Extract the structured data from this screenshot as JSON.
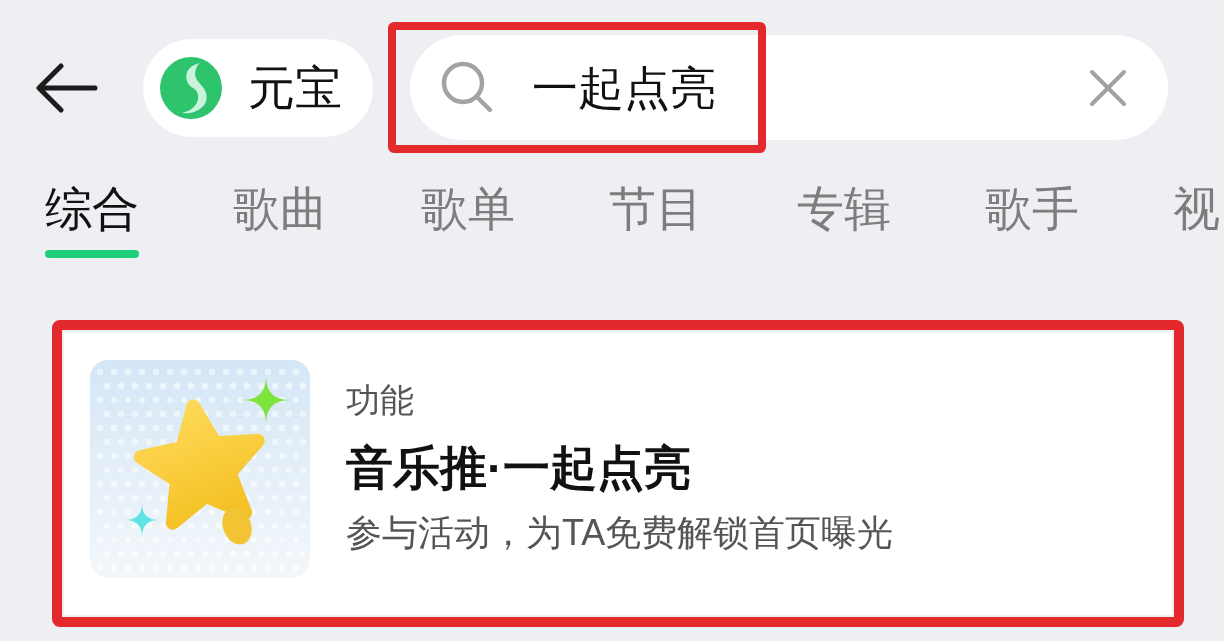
{
  "assistant_chip": {
    "label": "元宝"
  },
  "search": {
    "value": "一起点亮",
    "highlighted": true
  },
  "tabs": [
    {
      "label": "综合",
      "selected": true
    },
    {
      "label": "歌曲",
      "selected": false
    },
    {
      "label": "歌单",
      "selected": false
    },
    {
      "label": "节目",
      "selected": false
    },
    {
      "label": "专辑",
      "selected": false
    },
    {
      "label": "歌手",
      "selected": false
    },
    {
      "label": "视",
      "selected": false
    }
  ],
  "results": [
    {
      "kind": "feature",
      "category": "功能",
      "title": "音乐推·一起点亮",
      "description": "参与活动，为TA免费解锁首页曝光",
      "highlighted": true
    }
  ]
}
